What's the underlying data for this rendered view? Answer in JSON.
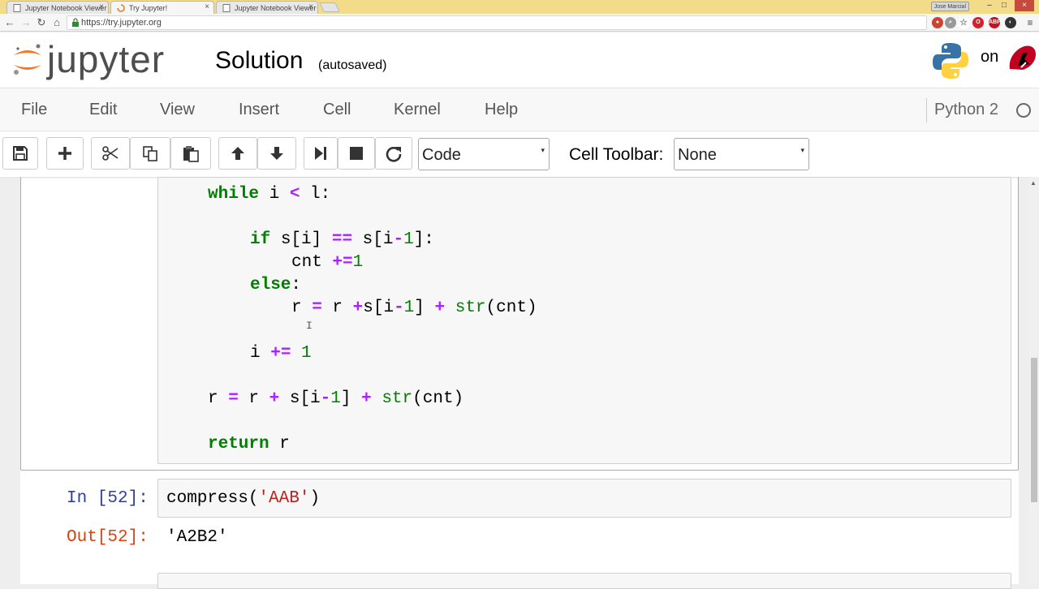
{
  "browser": {
    "tabs": [
      {
        "title": "Jupyter Notebook Viewer",
        "active": false
      },
      {
        "title": "Try Jupyter!",
        "active": true
      },
      {
        "title": "Jupyter Notebook Viewer",
        "active": false
      }
    ],
    "tab_close_glyph": "×",
    "user_badge": "Jose Marcial",
    "url": "https://try.jupyter.org",
    "window_controls": [
      "–",
      "□",
      "×"
    ]
  },
  "header": {
    "logo_text": "jupyter",
    "notebook_name": "Solution",
    "autosave_status": "(autosaved)",
    "on_text": "on"
  },
  "menubar": {
    "items": [
      "File",
      "Edit",
      "View",
      "Insert",
      "Cell",
      "Kernel",
      "Help"
    ],
    "kernel_name": "Python 2"
  },
  "toolbar": {
    "cell_type": "Code",
    "cell_toolbar_label": "Cell Toolbar:",
    "cell_toolbar_value": "None",
    "select_arrow": "▾"
  },
  "cells": {
    "code_lines": {
      "l1": {
        "kw": "while",
        "a": " i ",
        "op": "<",
        "b": " l:"
      },
      "l2": {
        "kw": "if",
        "a": " s[i] ",
        "op": "==",
        "b": " s[i",
        "op2": "-",
        "num": "1",
        "c": "]:"
      },
      "l3": {
        "a": "cnt ",
        "op": "+=",
        "num": "1"
      },
      "l4": {
        "kw": "else",
        "a": ":"
      },
      "l5": {
        "a": "r ",
        "op": "=",
        "b": " r ",
        "op2": "+",
        "c": "s[i",
        "op3": "-",
        "num": "1",
        "d": "] ",
        "op4": "+",
        "e": " ",
        "bi": "str",
        "f": "(cnt)"
      },
      "l6": {
        "a": "i ",
        "op": "+=",
        "b": " ",
        "num": "1"
      },
      "l7": {
        "a": "r ",
        "op": "=",
        "b": " r ",
        "op2": "+",
        "c": " s[i",
        "op3": "-",
        "num": "1",
        "d": "] ",
        "op4": "+",
        "e": " ",
        "bi": "str",
        "f": "(cnt)"
      },
      "l8": {
        "kw": "return",
        "a": " r"
      }
    },
    "input_prompt": "In [52]:",
    "input_code": {
      "a": "compress(",
      "str": "'AAB'",
      "b": ")"
    },
    "output_prompt": "Out[52]:",
    "output_text": "'A2B2'"
  },
  "colors": {
    "keyword": "#008000",
    "operator": "#aa22ff",
    "string": "#ba2121",
    "in_prompt": "#303f9f",
    "out_prompt": "#d84315",
    "jupyter_orange": "#f37726"
  }
}
